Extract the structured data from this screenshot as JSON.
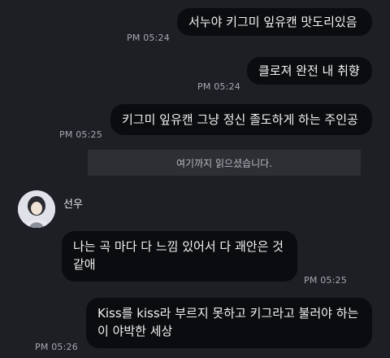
{
  "messages": [
    {
      "text": "서누야 키그미 잎유캔 맛도리있음",
      "time": "PM 05:24"
    },
    {
      "text": "클로져 완전 내 취향",
      "time": "PM 05:24"
    },
    {
      "text": "키그미 잎유캔 그냥 정신 졸도하게 하는 주인공",
      "time": "PM 05:25"
    },
    {
      "text": "나는 곡 마다 다 느낌 있어서 다 괘안은 것 같애",
      "time": "PM 05:25"
    },
    {
      "text": "Kiss를 kiss라 부르지 못하고 키그라고 불러야 하는 이 야박한 세상",
      "time": "PM 05:26"
    }
  ],
  "read_marker": "여기까지 읽으셨습니다.",
  "sender": {
    "name": "선우"
  }
}
